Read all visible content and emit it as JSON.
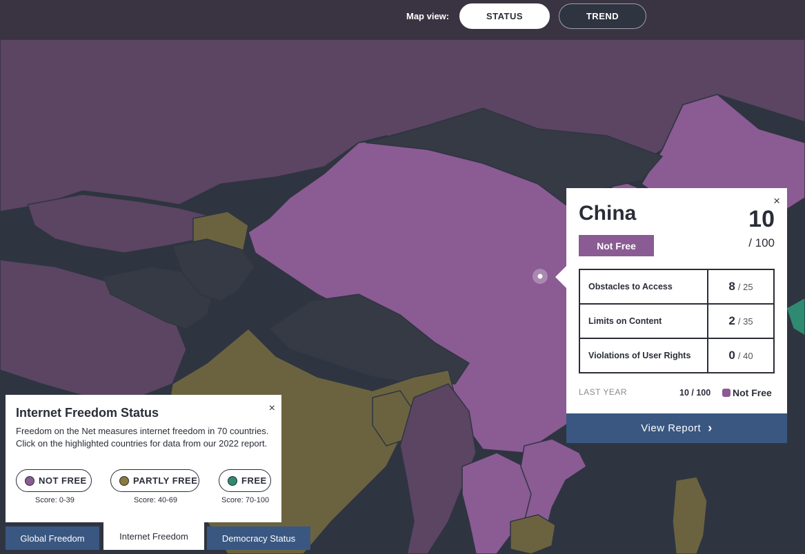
{
  "header": {
    "map_view_label": "Map view:",
    "buttons": [
      {
        "label": "STATUS",
        "active": true
      },
      {
        "label": "TREND",
        "active": false
      }
    ]
  },
  "map": {
    "colors": {
      "not_free": "#8b5b94",
      "not_free_dark": "#5b4563",
      "partly_free": "#6b6340",
      "free": "#2e8a70",
      "no_data": "#2f3540"
    }
  },
  "popup": {
    "close_label": "×",
    "country": "China",
    "status": "Not Free",
    "score": "10",
    "score_of": "/ 100",
    "categories": [
      {
        "name": "Obstacles to Access",
        "score": "8",
        "max": "/ 25"
      },
      {
        "name": "Limits on Content",
        "score": "2",
        "max": "/ 35"
      },
      {
        "name": "Violations of User Rights",
        "score": "0",
        "max": "/ 40"
      }
    ],
    "last_year_label": "LAST YEAR",
    "last_year_score": "10 / 100",
    "last_year_status": "Not Free",
    "view_report_label": "View Report",
    "view_report_icon": "chevron-right-icon"
  },
  "legend": {
    "close_label": "×",
    "title": "Internet Freedom Status",
    "description": "Freedom on the Net measures internet freedom in 70 countries. Click on the highlighted countries for data from our 2022 report.",
    "items": [
      {
        "label": "NOT FREE",
        "range": "Score: 0-39",
        "color": "#8b5b94"
      },
      {
        "label": "PARTLY FREE",
        "range": "Score: 40-69",
        "color": "#8a7a3e"
      },
      {
        "label": "FREE",
        "range": "Score: 70-100",
        "color": "#2e8a70"
      }
    ]
  },
  "tabs": [
    {
      "label": "Global Freedom",
      "active": false
    },
    {
      "label": "Internet Freedom",
      "active": true
    },
    {
      "label": "Democracy Status",
      "active": false
    }
  ]
}
